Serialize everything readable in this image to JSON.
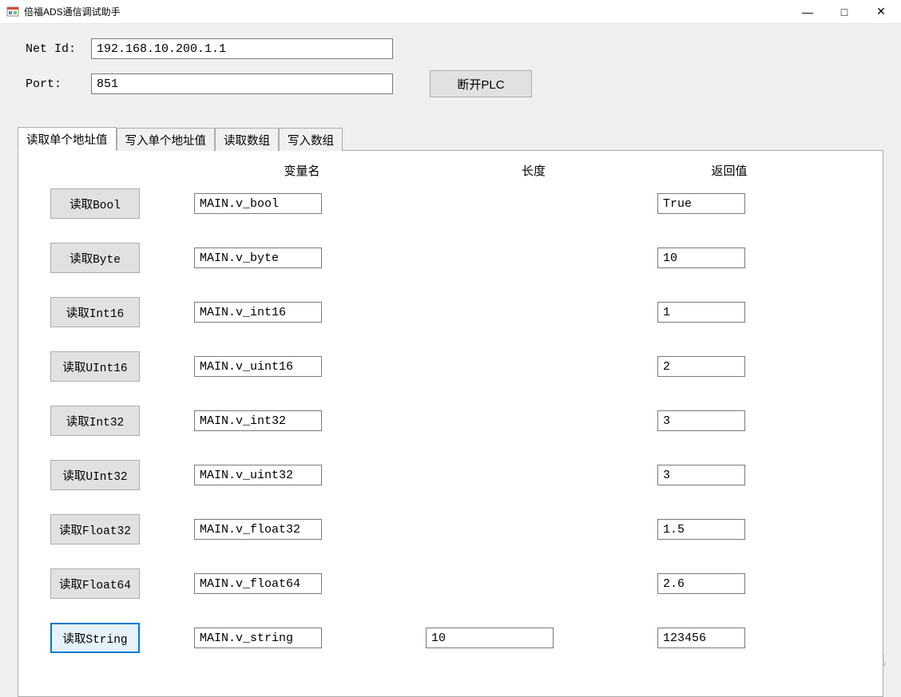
{
  "window": {
    "title": "倍福ADS通信调试助手"
  },
  "sysbuttons": {
    "min": "—",
    "max": "□",
    "close": "✕"
  },
  "form": {
    "netid_label": "Net Id:",
    "netid_value": "192.168.10.200.1.1",
    "port_label": "Port:",
    "port_value": "851",
    "disconnect_label": "断开PLC"
  },
  "tabs": {
    "read_single": "读取单个地址值",
    "write_single": "写入单个地址值",
    "read_array": "读取数组",
    "write_array": "写入数组"
  },
  "headers": {
    "variable": "变量名",
    "length": "长度",
    "result": "返回值"
  },
  "rows": [
    {
      "btn": "读取Bool",
      "var": "MAIN.v_bool",
      "len": "",
      "res": "True",
      "focused": false
    },
    {
      "btn": "读取Byte",
      "var": "MAIN.v_byte",
      "len": "",
      "res": "10",
      "focused": false
    },
    {
      "btn": "读取Int16",
      "var": "MAIN.v_int16",
      "len": "",
      "res": "1",
      "focused": false
    },
    {
      "btn": "读取UInt16",
      "var": "MAIN.v_uint16",
      "len": "",
      "res": "2",
      "focused": false
    },
    {
      "btn": "读取Int32",
      "var": "MAIN.v_int32",
      "len": "",
      "res": "3",
      "focused": false
    },
    {
      "btn": "读取UInt32",
      "var": "MAIN.v_uint32",
      "len": "",
      "res": "3",
      "focused": false
    },
    {
      "btn": "读取Float32",
      "var": "MAIN.v_float32",
      "len": "",
      "res": "1.5",
      "focused": false
    },
    {
      "btn": "读取Float64",
      "var": "MAIN.v_float64",
      "len": "",
      "res": "2.6",
      "focused": false
    },
    {
      "btn": "读取String",
      "var": "MAIN.v_string",
      "len": "10",
      "res": "123456",
      "focused": true
    }
  ],
  "watermark": "CSDN @c#上位机"
}
